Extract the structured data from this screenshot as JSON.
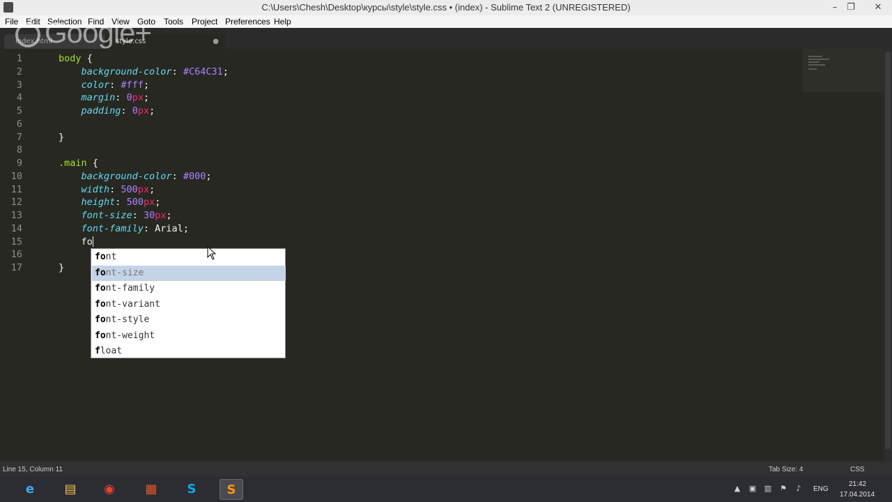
{
  "window": {
    "title": "C:\\Users\\Chesh\\Desktop\\курсы\\style\\style.css • (index) - Sublime Text 2 (UNREGISTERED)",
    "minimize_glyph": "–",
    "maximize_glyph": "❐",
    "close_glyph": "✕"
  },
  "menu": {
    "items": [
      "File",
      "Edit",
      "Selection",
      "Find",
      "View",
      "Goto",
      "Tools",
      "Project",
      "Preferences",
      "Help"
    ]
  },
  "watermark": {
    "text": "Google+"
  },
  "tabs": [
    {
      "label": "index.html",
      "active": false
    },
    {
      "label": "style.css",
      "active": true,
      "modified_glyph": "●"
    }
  ],
  "editor": {
    "lines": [
      {
        "n": "1",
        "tokens": [
          [
            "sel",
            "body"
          ],
          [
            "plain",
            " {"
          ]
        ]
      },
      {
        "n": "2",
        "tokens": [
          [
            "plain",
            "    "
          ],
          [
            "prop",
            "background-color"
          ],
          [
            "plain",
            ": "
          ],
          [
            "val",
            "#C64C31"
          ],
          [
            "plain",
            ";"
          ]
        ]
      },
      {
        "n": "3",
        "tokens": [
          [
            "plain",
            "    "
          ],
          [
            "prop",
            "color"
          ],
          [
            "plain",
            ": "
          ],
          [
            "val",
            "#fff"
          ],
          [
            "plain",
            ";"
          ]
        ]
      },
      {
        "n": "4",
        "tokens": [
          [
            "plain",
            "    "
          ],
          [
            "prop",
            "margin"
          ],
          [
            "plain",
            ": "
          ],
          [
            "val",
            "0"
          ],
          [
            "unit",
            "px"
          ],
          [
            "plain",
            ";"
          ]
        ]
      },
      {
        "n": "5",
        "tokens": [
          [
            "plain",
            "    "
          ],
          [
            "prop",
            "padding"
          ],
          [
            "plain",
            ": "
          ],
          [
            "val",
            "0"
          ],
          [
            "unit",
            "px"
          ],
          [
            "plain",
            ";"
          ]
        ]
      },
      {
        "n": "6",
        "tokens": []
      },
      {
        "n": "7",
        "tokens": [
          [
            "plain",
            "}"
          ]
        ]
      },
      {
        "n": "8",
        "tokens": []
      },
      {
        "n": "9",
        "tokens": [
          [
            "sel",
            ".main"
          ],
          [
            "plain",
            " {"
          ]
        ]
      },
      {
        "n": "10",
        "tokens": [
          [
            "plain",
            "    "
          ],
          [
            "prop",
            "background-color"
          ],
          [
            "plain",
            ": "
          ],
          [
            "val",
            "#000"
          ],
          [
            "plain",
            ";"
          ]
        ]
      },
      {
        "n": "11",
        "tokens": [
          [
            "plain",
            "    "
          ],
          [
            "prop",
            "width"
          ],
          [
            "plain",
            ": "
          ],
          [
            "val",
            "500"
          ],
          [
            "unit",
            "px"
          ],
          [
            "plain",
            ";"
          ]
        ]
      },
      {
        "n": "12",
        "tokens": [
          [
            "plain",
            "    "
          ],
          [
            "prop",
            "height"
          ],
          [
            "plain",
            ": "
          ],
          [
            "val",
            "500"
          ],
          [
            "unit",
            "px"
          ],
          [
            "plain",
            ";"
          ]
        ]
      },
      {
        "n": "13",
        "tokens": [
          [
            "plain",
            "    "
          ],
          [
            "prop",
            "font-size"
          ],
          [
            "plain",
            ": "
          ],
          [
            "val",
            "30"
          ],
          [
            "unit",
            "px"
          ],
          [
            "plain",
            ";"
          ]
        ]
      },
      {
        "n": "14",
        "tokens": [
          [
            "plain",
            "    "
          ],
          [
            "prop",
            "font-family"
          ],
          [
            "plain",
            ": Arial;"
          ]
        ]
      },
      {
        "n": "15",
        "tokens": [
          [
            "plain",
            "    fo"
          ]
        ],
        "caret": true
      },
      {
        "n": "16",
        "tokens": []
      },
      {
        "n": "17",
        "tokens": [
          [
            "plain",
            "}"
          ]
        ]
      }
    ]
  },
  "autocomplete": {
    "typed": "fo",
    "selected_index": 1,
    "items": [
      {
        "match": "fo",
        "rest": "nt"
      },
      {
        "match": "fo",
        "rest": "nt-size"
      },
      {
        "match": "fo",
        "rest": "nt-family"
      },
      {
        "match": "fo",
        "rest": "nt-variant"
      },
      {
        "match": "fo",
        "rest": "nt-style"
      },
      {
        "match": "fo",
        "rest": "nt-weight"
      },
      {
        "match": "f",
        "mid": "lo",
        "rest": "at"
      }
    ]
  },
  "status": {
    "position": "Line 15, Column 11",
    "tab_size": "Tab Size: 4",
    "syntax": "CSS"
  },
  "taskbar": {
    "language": "ENG",
    "time": "21:42",
    "date": "17.04.2014"
  },
  "colors": {
    "editor_bg": "#272822",
    "selector": "#a6e22e",
    "property": "#66d9ef",
    "number": "#ae81ff",
    "unit": "#f92672",
    "ac_selected_bg": "#c3d4e8"
  }
}
